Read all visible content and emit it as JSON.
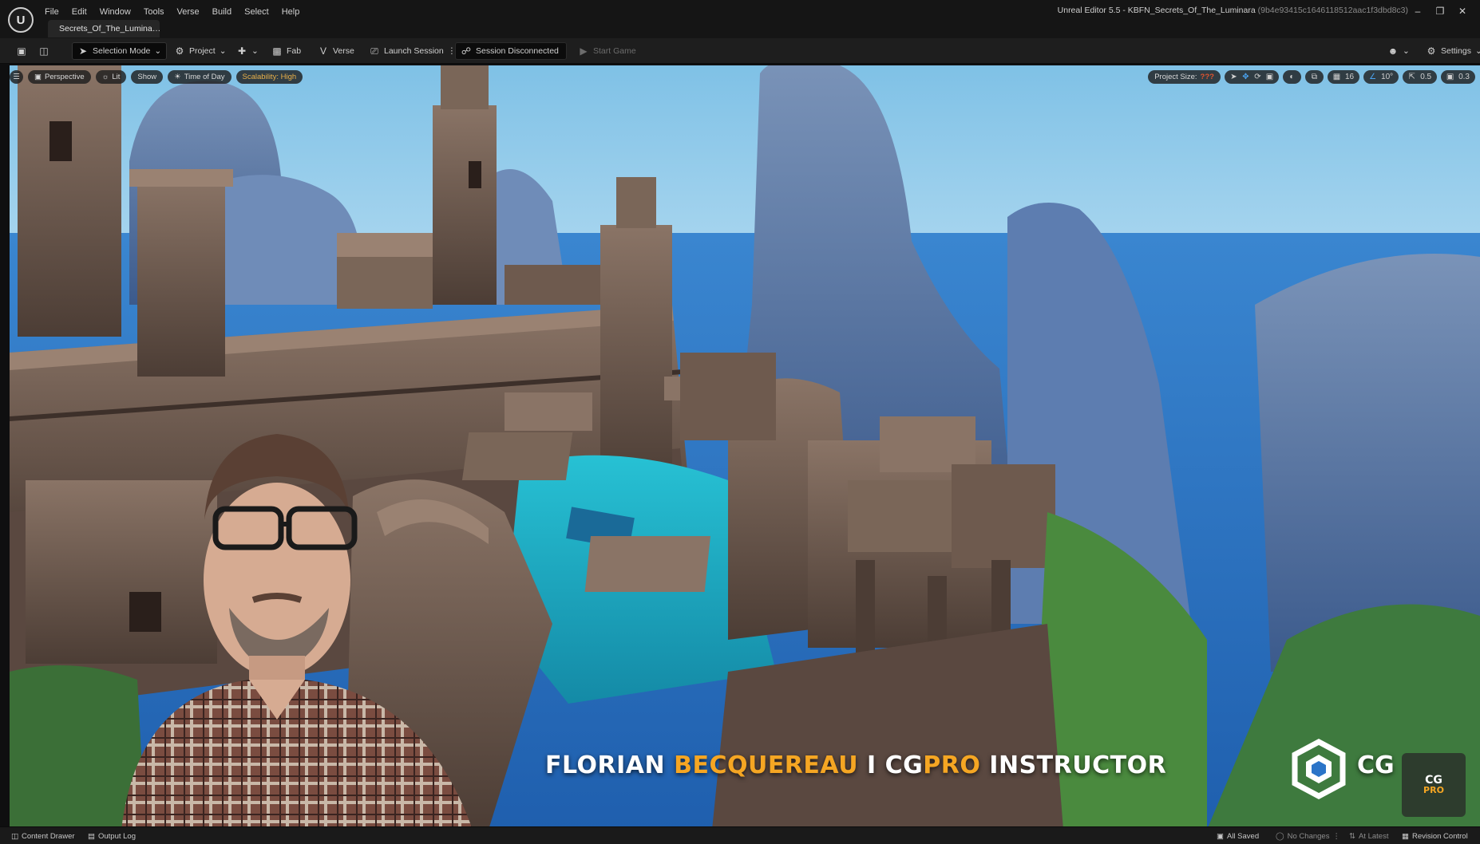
{
  "app": {
    "window_title": "Unreal Editor 5.5 - KBFN_Secrets_Of_The_Luminara",
    "window_hash": "(9b4e93415c1646118512aac1f3dbd8c3)",
    "document_tab": "Secrets_Of_The_Lumina…"
  },
  "menu": [
    "File",
    "Edit",
    "Window",
    "Tools",
    "Verse",
    "Build",
    "Select",
    "Help"
  ],
  "toolbar": {
    "selection_mode": "Selection Mode",
    "project": "Project",
    "fab": "Fab",
    "verse": "Verse",
    "launch_session": "Launch Session",
    "session_status": "Session Disconnected",
    "start_game": "Start Game",
    "settings": "Settings"
  },
  "viewport": {
    "perspective": "Perspective",
    "lit": "Lit",
    "show": "Show",
    "time_of_day": "Time of Day",
    "scalability": "Scalability: High",
    "project_size_label": "Project Size:",
    "project_size_value": "???",
    "grid_snap": "16",
    "rotation_snap": "10°",
    "scale_snap": "0.5",
    "camera_speed": "0.3"
  },
  "overlay": {
    "name_first": "FLORIAN ",
    "name_last": "BECQUEREAU",
    "separator": " I ",
    "brand_cg": "CG",
    "brand_pro": "PRO",
    "role": " INSTRUCTOR",
    "logo_text": "CG",
    "badge_top": "CG",
    "badge_bottom": "PRO"
  },
  "statusbar": {
    "content_drawer": "Content Drawer",
    "output_log": "Output Log",
    "all_saved": "All Saved",
    "no_changes": "No Changes",
    "at_latest": "At Latest",
    "revision_control": "Revision Control"
  },
  "colors": {
    "sky_top": "#7fc1e6",
    "sea": "#2b74c8",
    "water": "#1fb0c6",
    "stone": "#6e5a4e",
    "accent_orange": "#f5a623",
    "ue_active_blue": "#4aa3f0"
  }
}
